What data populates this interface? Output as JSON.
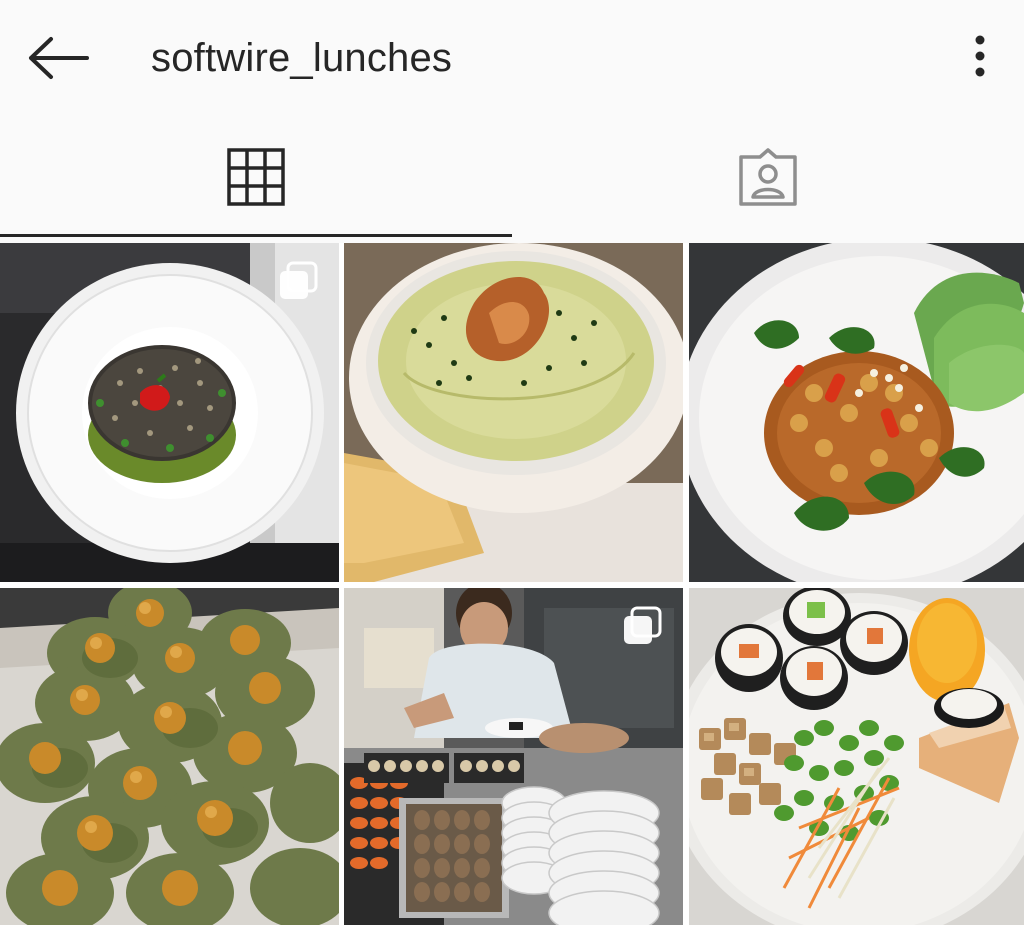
{
  "header": {
    "username": "softwire_lunches",
    "back_icon": "arrow-left-icon",
    "more_icon": "more-vertical-icon"
  },
  "tabs": [
    {
      "name": "grid",
      "icon": "grid-icon",
      "selected": true
    },
    {
      "name": "tagged",
      "icon": "tagged-person-icon",
      "selected": false
    }
  ],
  "posts": [
    {
      "subject": "black rice salad with chili on white plate",
      "multi_photo": true
    },
    {
      "subject": "green soup with crispy topping in bowl",
      "multi_photo": false
    },
    {
      "subject": "chickpea curry with lettuce and coriander",
      "multi_photo": false
    },
    {
      "subject": "stuffed vine leaves on tray",
      "multi_photo": false
    },
    {
      "subject": "chef plating sushi in kitchen",
      "multi_photo": true
    },
    {
      "subject": "sushi, edamame, tofu and mango plate",
      "multi_photo": false
    }
  ],
  "colors": {
    "text": "#262626",
    "icon": "#262626",
    "icon_inactive": "#8e8e8e",
    "background": "#fafafa"
  }
}
